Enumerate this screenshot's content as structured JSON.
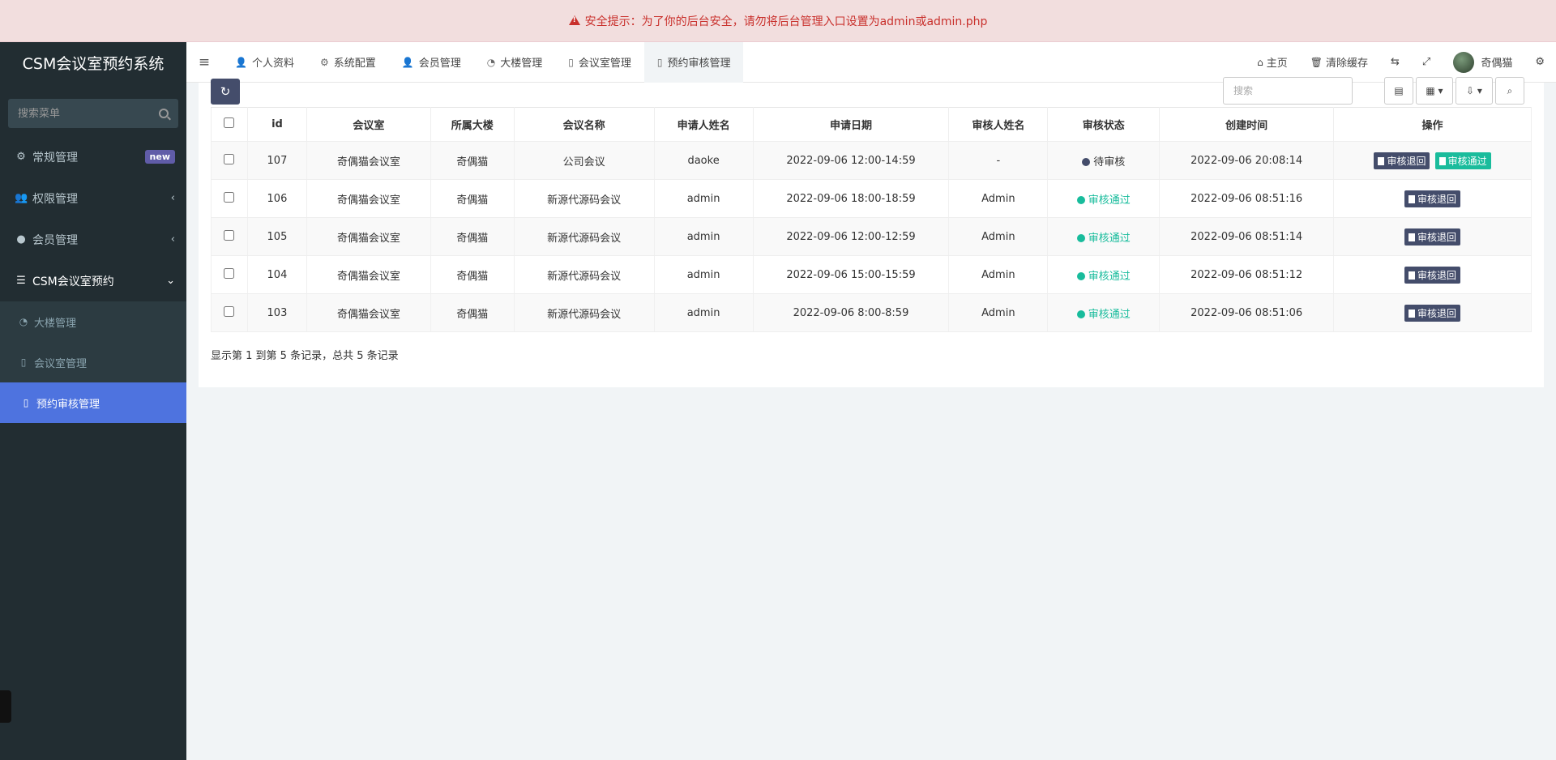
{
  "banner": {
    "text": "安全提示：为了你的后台安全，请勿将后台管理入口设置为admin或admin.php"
  },
  "sidebar": {
    "logo": "CSM会议室预约系统",
    "search_placeholder": "搜索菜单",
    "items": [
      {
        "label": "常规管理",
        "icon": "gears-icon",
        "badge": "new"
      },
      {
        "label": "权限管理",
        "icon": "users-icon",
        "arrow": "‹"
      },
      {
        "label": "会员管理",
        "icon": "user-circle-icon",
        "arrow": "‹"
      },
      {
        "label": "CSM会议室预约",
        "icon": "list-icon",
        "arrow": "⌄"
      }
    ],
    "sub_items": [
      {
        "label": "大楼管理",
        "icon": "dashboard-icon"
      },
      {
        "label": "会议室管理",
        "icon": "file-icon"
      },
      {
        "label": "预约审核管理",
        "icon": "file-icon"
      }
    ]
  },
  "topnav": {
    "tabs": [
      {
        "label": "个人资料",
        "icon": "user-icon"
      },
      {
        "label": "系统配置",
        "icon": "gear-icon"
      },
      {
        "label": "会员管理",
        "icon": "user-icon"
      },
      {
        "label": "大楼管理",
        "icon": "dashboard-icon"
      },
      {
        "label": "会议室管理",
        "icon": "file-icon"
      },
      {
        "label": "预约审核管理",
        "icon": "file-icon"
      }
    ],
    "home": "主页",
    "clear_cache": "清除缓存",
    "username": "奇偶猫"
  },
  "toolbar": {
    "search_placeholder": "搜索"
  },
  "table": {
    "columns": [
      "id",
      "会议室",
      "所属大楼",
      "会议名称",
      "申请人姓名",
      "申请日期",
      "审核人姓名",
      "审核状态",
      "创建时间",
      "操作"
    ],
    "rows": [
      {
        "id": "107",
        "room": "奇偶猫会议室",
        "building": "奇偶猫",
        "meeting": "公司会议",
        "applicant": "daoke",
        "date": "2022-09-06 12:00-14:59",
        "reviewer": "-",
        "status": "待审核",
        "created": "2022-09-06 20:08:14"
      },
      {
        "id": "106",
        "room": "奇偶猫会议室",
        "building": "奇偶猫",
        "meeting": "新源代源码会议",
        "applicant": "admin",
        "date": "2022-09-06 18:00-18:59",
        "reviewer": "Admin",
        "status": "审核通过",
        "created": "2022-09-06 08:51:16"
      },
      {
        "id": "105",
        "room": "奇偶猫会议室",
        "building": "奇偶猫",
        "meeting": "新源代源码会议",
        "applicant": "admin",
        "date": "2022-09-06 12:00-12:59",
        "reviewer": "Admin",
        "status": "审核通过",
        "created": "2022-09-06 08:51:14"
      },
      {
        "id": "104",
        "room": "奇偶猫会议室",
        "building": "奇偶猫",
        "meeting": "新源代源码会议",
        "applicant": "admin",
        "date": "2022-09-06 15:00-15:59",
        "reviewer": "Admin",
        "status": "审核通过",
        "created": "2022-09-06 08:51:12"
      },
      {
        "id": "103",
        "room": "奇偶猫会议室",
        "building": "奇偶猫",
        "meeting": "新源代源码会议",
        "applicant": "admin",
        "date": "2022-09-06 8:00-8:59",
        "reviewer": "Admin",
        "status": "审核通过",
        "created": "2022-09-06 08:51:06"
      }
    ],
    "op_back": "审核退回",
    "op_pass": "审核通过"
  },
  "footer": {
    "text": "显示第 1 到第 5 条记录，总共 5 条记录"
  },
  "colors": {
    "accent": "#4e73df",
    "pass": "#18bc9c",
    "dark_btn": "#444d6b",
    "banner_text": "#c9302c"
  }
}
